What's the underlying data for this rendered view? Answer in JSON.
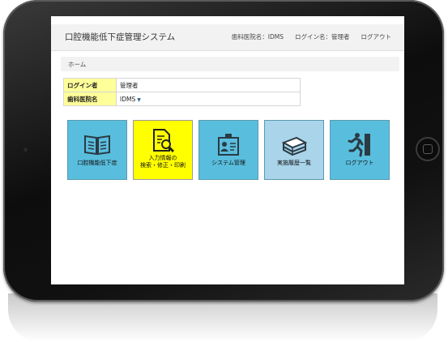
{
  "app": {
    "title": "口腔機能低下症管理システム"
  },
  "navbar": {
    "clinic_label": "歯科医院名：IDMS",
    "login_label": "ログイン名：管理者",
    "logout_label": "ログアウト"
  },
  "breadcrumb": {
    "home": "ホーム"
  },
  "info": {
    "rows": [
      {
        "key": "ログイン者",
        "value": "管理者"
      },
      {
        "key": "歯科医院名",
        "value": "IDMS"
      }
    ]
  },
  "tiles": [
    {
      "label": "口腔機能低下症",
      "icon": "book-icon",
      "color": "#59bedd"
    },
    {
      "label": "入力情報の\n検索・修正・印刷",
      "icon": "document-search-icon",
      "color": "#ffff00"
    },
    {
      "label": "システム管理",
      "icon": "id-badge-icon",
      "color": "#59bedd"
    },
    {
      "label": "実施履歴一覧",
      "icon": "books-stack-icon",
      "color": "#a9d4ea"
    },
    {
      "label": "ログアウト",
      "icon": "running-exit-icon",
      "color": "#59bedd"
    }
  ]
}
